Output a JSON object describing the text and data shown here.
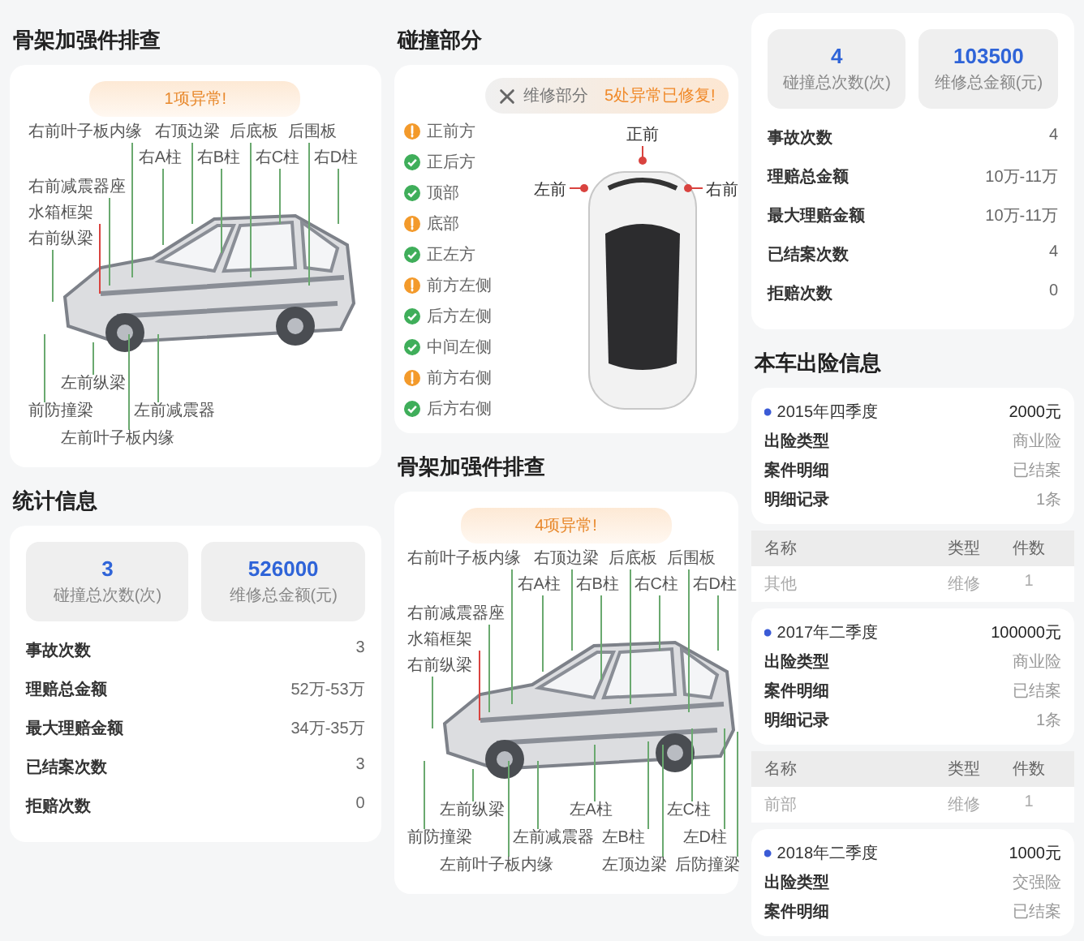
{
  "skeleton_check_1": {
    "title": "骨架加强件排查",
    "badge": "1项异常!",
    "parts": [
      {
        "label": "右前叶子板内缘",
        "abnormal": false
      },
      {
        "label": "右顶边梁",
        "abnormal": false
      },
      {
        "label": "后底板",
        "abnormal": false
      },
      {
        "label": "后围板",
        "abnormal": false
      },
      {
        "label": "右A柱",
        "abnormal": false
      },
      {
        "label": "右B柱",
        "abnormal": false
      },
      {
        "label": "右C柱",
        "abnormal": false
      },
      {
        "label": "右D柱",
        "abnormal": false
      },
      {
        "label": "右前减震器座",
        "abnormal": false
      },
      {
        "label": "水箱框架",
        "abnormal": true
      },
      {
        "label": "右前纵梁",
        "abnormal": false
      },
      {
        "label": "左前纵梁",
        "abnormal": false
      },
      {
        "label": "前防撞梁",
        "abnormal": false
      },
      {
        "label": "左前减震器",
        "abnormal": false
      },
      {
        "label": "左前叶子板内缘",
        "abnormal": false
      }
    ]
  },
  "statistics": {
    "title": "统计信息",
    "tiles": [
      {
        "value": "3",
        "caption": "碰撞总次数(次)"
      },
      {
        "value": "526000",
        "caption": "维修总金额(元)"
      }
    ],
    "rows": [
      {
        "label": "事故次数",
        "value": "3"
      },
      {
        "label": "理赔总金额",
        "value": "52万-53万"
      },
      {
        "label": "最大理赔金额",
        "value": "34万-35万"
      },
      {
        "label": "已结案次数",
        "value": "3"
      },
      {
        "label": "拒赔次数",
        "value": "0"
      }
    ]
  },
  "collision": {
    "title": "碰撞部分",
    "repair_label": "维修部分",
    "summary": "5处异常已修复!",
    "items": [
      {
        "label": "正前方",
        "abnormal": true
      },
      {
        "label": "正后方",
        "abnormal": false
      },
      {
        "label": "顶部",
        "abnormal": false
      },
      {
        "label": "底部",
        "abnormal": true
      },
      {
        "label": "正左方",
        "abnormal": false
      },
      {
        "label": "前方左侧",
        "abnormal": true
      },
      {
        "label": "后方左侧",
        "abnormal": false
      },
      {
        "label": "中间左侧",
        "abnormal": false
      },
      {
        "label": "前方右侧",
        "abnormal": true
      },
      {
        "label": "后方右侧",
        "abnormal": false
      }
    ],
    "car_labels": [
      "正前",
      "左前",
      "右前"
    ]
  },
  "skeleton_check_2": {
    "title": "骨架加强件排查",
    "badge": "4项异常!",
    "parts": [
      {
        "label": "右前叶子板内缘",
        "abnormal": false
      },
      {
        "label": "右顶边梁",
        "abnormal": false
      },
      {
        "label": "后底板",
        "abnormal": false
      },
      {
        "label": "后围板",
        "abnormal": false
      },
      {
        "label": "右A柱",
        "abnormal": false
      },
      {
        "label": "右B柱",
        "abnormal": false
      },
      {
        "label": "右C柱",
        "abnormal": false
      },
      {
        "label": "右D柱",
        "abnormal": false
      },
      {
        "label": "右前减震器座",
        "abnormal": false
      },
      {
        "label": "水箱框架",
        "abnormal": true
      },
      {
        "label": "右前纵梁",
        "abnormal": false
      },
      {
        "label": "左前纵梁",
        "abnormal": false
      },
      {
        "label": "左A柱",
        "abnormal": false
      },
      {
        "label": "左C柱",
        "abnormal": false
      },
      {
        "label": "前防撞梁",
        "abnormal": false
      },
      {
        "label": "左前减震器",
        "abnormal": false
      },
      {
        "label": "左B柱",
        "abnormal": false
      },
      {
        "label": "左D柱",
        "abnormal": false
      },
      {
        "label": "左前叶子板内缘",
        "abnormal": false
      },
      {
        "label": "左顶边梁",
        "abnormal": false
      },
      {
        "label": "后防撞梁",
        "abnormal": false
      }
    ]
  },
  "vehicle_stats": {
    "tiles": [
      {
        "value": "4",
        "caption": "碰撞总次数(次)"
      },
      {
        "value": "103500",
        "caption": "维修总金额(元)"
      }
    ],
    "rows": [
      {
        "label": "事故次数",
        "value": "4"
      },
      {
        "label": "理赔总金额",
        "value": "10万-11万"
      },
      {
        "label": "最大理赔金额",
        "value": "10万-11万"
      },
      {
        "label": "已结案次数",
        "value": "4"
      },
      {
        "label": "拒赔次数",
        "value": "0"
      }
    ]
  },
  "claims": {
    "title": "本车出险信息",
    "entries": [
      {
        "kind": "record",
        "period": "2015年四季度",
        "amount": "2000元",
        "rows": [
          {
            "label": "出险类型",
            "value": "商业险"
          },
          {
            "label": "案件明细",
            "value": "已结案"
          },
          {
            "label": "明细记录",
            "value": "1条"
          }
        ]
      },
      {
        "kind": "table",
        "columns": [
          "名称",
          "类型",
          "件数"
        ],
        "rows": [
          [
            "其他",
            "维修",
            "1"
          ]
        ]
      },
      {
        "kind": "record",
        "period": "2017年二季度",
        "amount": "100000元",
        "rows": [
          {
            "label": "出险类型",
            "value": "商业险"
          },
          {
            "label": "案件明细",
            "value": "已结案"
          },
          {
            "label": "明细记录",
            "value": "1条"
          }
        ]
      },
      {
        "kind": "table",
        "columns": [
          "名称",
          "类型",
          "件数"
        ],
        "rows": [
          [
            "前部",
            "维修",
            "1"
          ]
        ]
      },
      {
        "kind": "record",
        "period": "2018年二季度",
        "amount": "1000元",
        "rows": [
          {
            "label": "出险类型",
            "value": "交强险"
          },
          {
            "label": "案件明细",
            "value": "已结案"
          }
        ]
      }
    ]
  }
}
